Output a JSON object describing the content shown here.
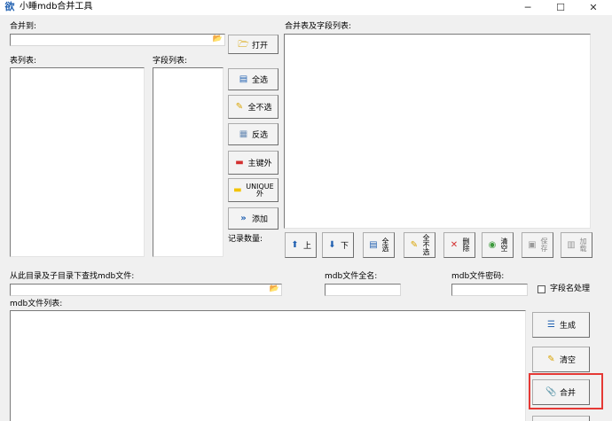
{
  "window": {
    "title": "小睡mdb合并工具",
    "app_icon_glyph": "欲",
    "minimize_glyph": "─",
    "maximize_glyph": "☐",
    "close_glyph": "✕"
  },
  "merge_to": {
    "label": "合并到:",
    "value": "",
    "open_button": "打开"
  },
  "tables": {
    "label": "表列表:"
  },
  "fields": {
    "label": "字段列表:"
  },
  "merge_list": {
    "label": "合并表及字段列表:",
    "record_count_label": "记录数量:"
  },
  "middle_buttons": {
    "select_all": "全选",
    "select_none": "全不选",
    "invert": "反选",
    "except_primary": "主键外",
    "except_unique_top": "UNIQUE",
    "except_unique_bottom": "外",
    "add": "添加"
  },
  "bottom_toolbar": {
    "up": "上",
    "down": "下",
    "select_all_top": "全",
    "select_all_bottom": "选",
    "select_none_top": "全",
    "select_none_mid": "不",
    "select_none_bottom": "选",
    "delete_top": "删",
    "delete_bottom": "除",
    "clear_top": "清",
    "clear_bottom": "空",
    "save_top": "保",
    "save_bottom": "存",
    "load_top": "加",
    "load_bottom": "载"
  },
  "search": {
    "dir_label": "从此目录及子目录下查找mdb文件:",
    "dir_value": "",
    "fullname_label": "mdb文件全名:",
    "fullname_value": "",
    "password_label": "mdb文件密码:",
    "password_value": "",
    "field_case_label": "字段名处理"
  },
  "mdb_list": {
    "label": "mdb文件列表:"
  },
  "right_buttons": {
    "generate": "生成",
    "clear": "清空",
    "merge": "合并"
  },
  "colors": {
    "highlight": "#e53935",
    "accent_blue": "#1f5fb0",
    "red": "#d32f2f",
    "yellow": "#f2c200"
  }
}
